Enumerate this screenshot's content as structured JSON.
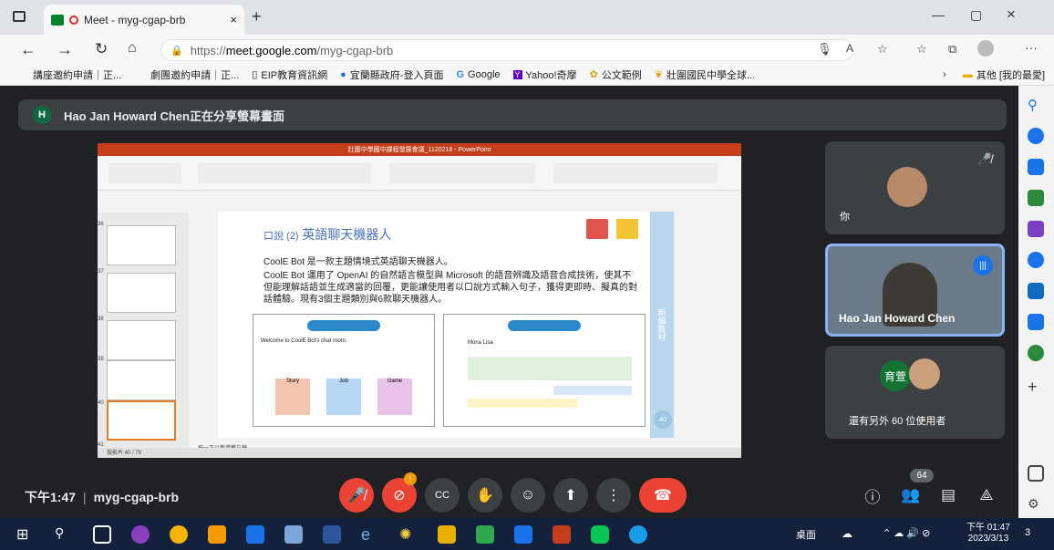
{
  "browser": {
    "tab_title": "Meet - myg-cgap-brb",
    "url_prefix": "https://",
    "url_host": "meet.google.com",
    "url_path": "/myg-cgap-brb",
    "bookmarks": [
      "講座邀約申請｜正...",
      "劇團邀約申請｜正...",
      "EIP教育資訊網",
      "宜蘭縣政府-登入頁面",
      "Google",
      "Yahoo!奇摩",
      "公文範例",
      "壯圍國民中學全球..."
    ],
    "other_bookmarks": "其他 [我的最愛]"
  },
  "meet": {
    "presenting_initial": "H",
    "presenting_text": "Hao Jan Howard Chen正在分享螢幕畫面",
    "tiles": [
      {
        "name": "你"
      },
      {
        "name": "Hao Jan Howard Chen"
      },
      {
        "name": "還有另外 60 位使用者",
        "avatar_text": "育萱"
      }
    ],
    "clock": "下午1:47",
    "meeting_code": "myg-cgap-brb",
    "participants_badge": "64"
  },
  "slide": {
    "title_bar": "壯圍中學國中課程發展會議_1120218 - PowerPoint",
    "heading_prefix": "口說 (2)",
    "heading": "英語聊天機器人",
    "p1": "CoolE Bot 是一款主題情境式英語聊天機器人。",
    "p2": "CoolE Bot 運用了 OpenAI 的自然語言模型與 Microsoft 的語音辨識及語音合成技術，使其不但能理解話語並生成適當的回覆，更能讓使用者以口說方式輸入句子，獲得更即時、擬真的對話體驗。現有3個主題類別與6款聊天機器人。",
    "panel_a_title": "Welcome to CoolE Bot's chat room.",
    "panel_a_cats": [
      "Story",
      "Job",
      "Game"
    ],
    "panel_b_name": "Mona Lisa",
    "side_text": "新編教材",
    "page_num": "40",
    "status": "投影片 40 / 79",
    "notes": "按一下以新增備忘稿",
    "thumb_nums": [
      "36",
      "37",
      "38",
      "39",
      "40",
      "41"
    ]
  },
  "taskbar": {
    "desktop": "桌面",
    "time": "下午 01:47",
    "date": "2023/3/13",
    "notif": "3"
  }
}
